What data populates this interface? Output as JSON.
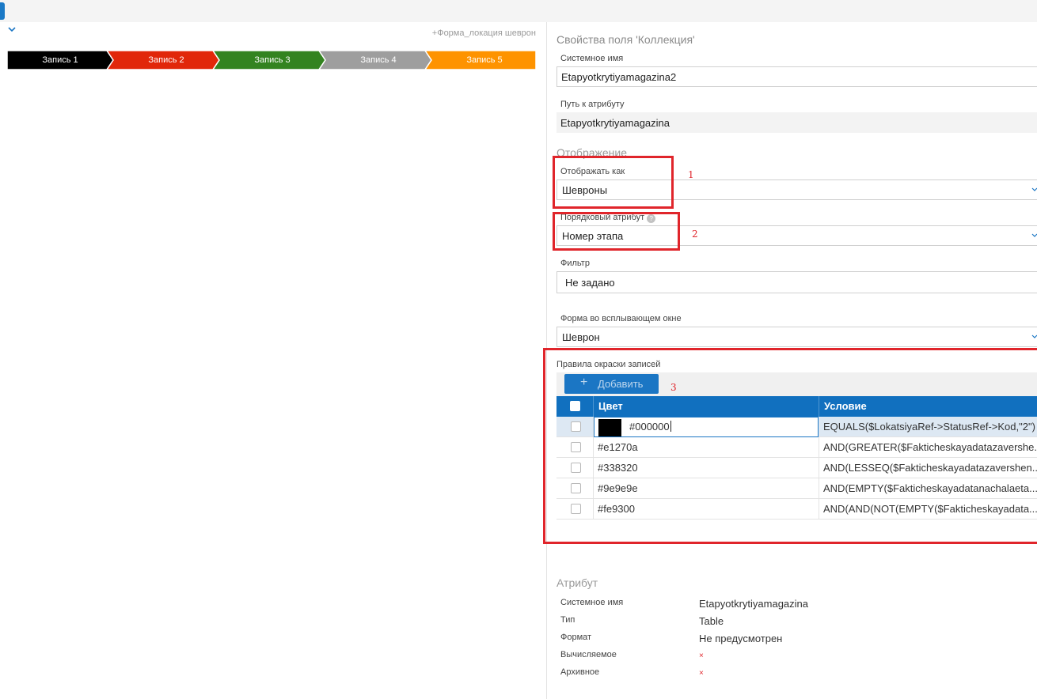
{
  "form_link": "+Форма_локация шеврон",
  "chevrons": [
    {
      "label": "Запись 1",
      "color": "#000000"
    },
    {
      "label": "Запись 2",
      "color": "#e1270a"
    },
    {
      "label": "Запись 3",
      "color": "#338320"
    },
    {
      "label": "Запись 4",
      "color": "#9e9e9e"
    },
    {
      "label": "Запись 5",
      "color": "#fe9300"
    }
  ],
  "panel": {
    "title": "Свойства поля 'Коллекция'",
    "system_name": {
      "label": "Системное имя",
      "value": "Etapyotkrytiyamagazina2"
    },
    "attribute_path": {
      "label": "Путь к атрибуту",
      "value": "Etapyotkrytiyamagazina"
    },
    "display_section": "Отображение",
    "display_as": {
      "label": "Отображать как",
      "value": "Шевроны"
    },
    "order_attribute": {
      "label": "Порядковый атрибут",
      "value": "Номер этапа",
      "help": "?"
    },
    "filter": {
      "label": "Фильтр",
      "value": "Не задано"
    },
    "popup_form": {
      "label": "Форма во всплывающем окне",
      "value": "Шеврон"
    },
    "coloring_rules": {
      "label": "Правила окраски записей",
      "add_button": "Добавить",
      "add_icon": "+",
      "columns": {
        "color": "Цвет",
        "condition": "Условие"
      },
      "rows": [
        {
          "color": "#000000",
          "condition": "EQUALS($LokatsiyaRef->StatusRef->Kod,\"2\")"
        },
        {
          "color": "#e1270a",
          "condition": "AND(GREATER($Fakticheskayadatazavershe..."
        },
        {
          "color": "#338320",
          "condition": "AND(LESSEQ($Fakticheskayadatazavershen..."
        },
        {
          "color": "#9e9e9e",
          "condition": "AND(EMPTY($Fakticheskayadatanachalaeta..."
        },
        {
          "color": "#fe9300",
          "condition": "AND(AND(NOT(EMPTY($Fakticheskayadata..."
        }
      ]
    },
    "attribute": {
      "title": "Атрибут",
      "system_name": {
        "label": "Системное имя",
        "value": "Etapyotkrytiyamagazina"
      },
      "type": {
        "label": "Тип",
        "value": "Table"
      },
      "format": {
        "label": "Формат",
        "value": "Не предусмотрен"
      },
      "computed": {
        "label": "Вычисляемое",
        "value": "×"
      },
      "archived": {
        "label": "Архивное",
        "value": "×"
      }
    }
  },
  "annotations": [
    "1",
    "2",
    "3"
  ]
}
